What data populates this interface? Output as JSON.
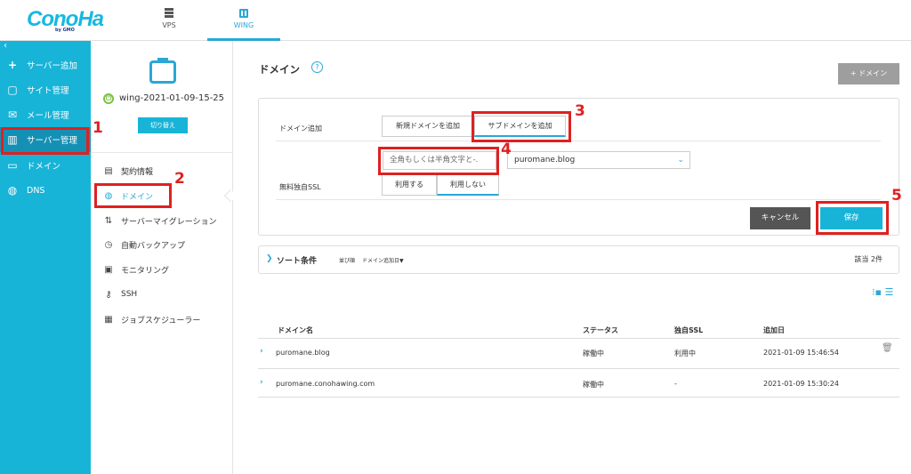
{
  "header": {
    "logo": "ConoHa",
    "logo_sub": "by GMO",
    "tabs": [
      {
        "label": "VPS",
        "icon": "server-rack-icon"
      },
      {
        "label": "WING",
        "icon": "wing-server-icon"
      }
    ]
  },
  "sidebar": {
    "collapse": "‹",
    "items": [
      {
        "label": "サーバー追加",
        "icon": "plus-icon"
      },
      {
        "label": "サイト管理",
        "icon": "site-icon"
      },
      {
        "label": "メール管理",
        "icon": "mail-icon"
      },
      {
        "label": "サーバー管理",
        "icon": "server-icon"
      },
      {
        "label": "ドメイン",
        "icon": "domain-icon"
      },
      {
        "label": "DNS",
        "icon": "globe-icon"
      }
    ]
  },
  "server_panel": {
    "server_name": "wing-2021-01-09-15-25",
    "switch_label": "切り替え",
    "menu": [
      {
        "label": "契約情報",
        "icon": "contract-icon"
      },
      {
        "label": "ドメイン",
        "icon": "globe-icon"
      },
      {
        "label": "サーバーマイグレーション",
        "icon": "migration-icon"
      },
      {
        "label": "自動バックアップ",
        "icon": "backup-icon"
      },
      {
        "label": "モニタリング",
        "icon": "monitor-icon"
      },
      {
        "label": "SSH",
        "icon": "key-icon"
      },
      {
        "label": "ジョブスケジューラー",
        "icon": "scheduler-icon"
      }
    ]
  },
  "main": {
    "title": "ドメイン",
    "help": "?",
    "add_button": "+ ドメイン",
    "form": {
      "domain_add_label": "ドメイン追加",
      "new_domain": "新規ドメインを追加",
      "sub_domain": "サブドメインを追加",
      "subdomain_placeholder": "全角もしくは半角文字と-.",
      "domain_select_value": "puromane.blog",
      "ssl_label": "無料独自SSL",
      "ssl_use": "利用する",
      "ssl_no_use": "利用しない",
      "cancel": "キャンセル",
      "save": "保存"
    },
    "sort": {
      "title": "ソート条件",
      "order_label": "並び順",
      "order_value": "ドメイン追加日▼",
      "count": "該当 2件"
    },
    "table": {
      "headers": [
        "ドメイン名",
        "ステータス",
        "独自SSL",
        "追加日"
      ],
      "rows": [
        {
          "domain": "puromane.blog",
          "status": "稼働中",
          "ssl": "利用中",
          "date": "2021-01-09 15:46:54"
        },
        {
          "domain": "puromane.conohawing.com",
          "status": "稼働中",
          "ssl": "-",
          "date": "2021-01-09 15:30:24"
        }
      ]
    }
  },
  "annotations": [
    "1",
    "2",
    "3",
    "4",
    "5"
  ],
  "colors": {
    "accent": "#18b4d8",
    "annotation": "#e02020"
  }
}
